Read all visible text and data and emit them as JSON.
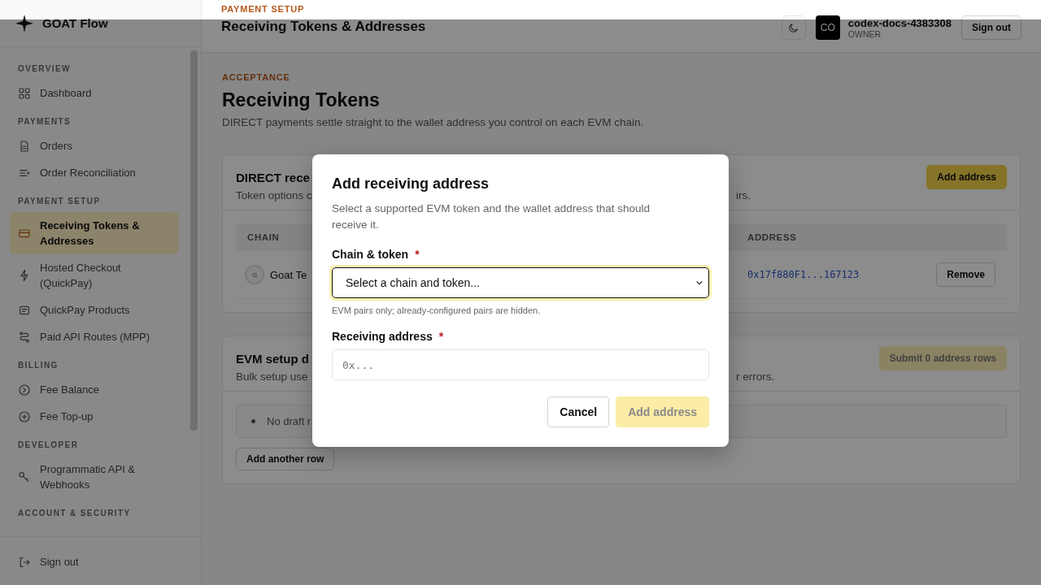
{
  "brand": {
    "name": "GOAT Flow"
  },
  "header": {
    "eyebrow": "PAYMENT SETUP",
    "title": "Receiving Tokens & Addresses",
    "avatar": "CO",
    "user_name": "codex-docs-4383308",
    "role": "OWNER",
    "sign_out": "Sign out"
  },
  "sidebar": {
    "sections": [
      {
        "heading": "OVERVIEW",
        "items": [
          {
            "label": "Dashboard",
            "selected": false
          }
        ]
      },
      {
        "heading": "PAYMENTS",
        "items": [
          {
            "label": "Orders",
            "selected": false
          },
          {
            "label": "Order Reconciliation",
            "selected": false
          }
        ]
      },
      {
        "heading": "PAYMENT SETUP",
        "items": [
          {
            "label": "Receiving Tokens & Addresses",
            "selected": true
          },
          {
            "label": "Hosted Checkout (QuickPay)",
            "selected": false
          },
          {
            "label": "QuickPay Products",
            "selected": false
          },
          {
            "label": "Paid API Routes (MPP)",
            "selected": false
          }
        ]
      },
      {
        "heading": "BILLING",
        "items": [
          {
            "label": "Fee Balance",
            "selected": false
          },
          {
            "label": "Fee Top-up",
            "selected": false
          }
        ]
      },
      {
        "heading": "DEVELOPER",
        "items": [
          {
            "label": "Programmatic API & Webhooks",
            "selected": false
          }
        ]
      },
      {
        "heading": "ACCOUNT & SECURITY"
      }
    ],
    "sign_out": "Sign out"
  },
  "page": {
    "eyebrow": "ACCEPTANCE",
    "title": "Receiving Tokens",
    "description": "DIRECT payments settle straight to the wallet address you control on each EVM chain."
  },
  "direct_card": {
    "title": "DIRECT rece",
    "subtitle_left": "Token options c",
    "subtitle_right": "irs.",
    "button": "Add address",
    "table": {
      "columns": [
        "CHAIN",
        "ADDRESS"
      ],
      "rows": [
        {
          "token_badge": "G",
          "chain": "Goat Te",
          "address": "0x17f880F1...167123",
          "action": "Remove"
        }
      ]
    }
  },
  "setup_card": {
    "title": "EVM setup d",
    "subtitle_left": "Bulk setup use",
    "subtitle_right": "r errors.",
    "button": "Submit 0 address rows",
    "button_disabled": true,
    "empty_note": "No draft r",
    "add_row": "Add another row"
  },
  "modal": {
    "title": "Add receiving address",
    "description": "Select a supported EVM token and the wallet address that should receive it.",
    "fields": [
      {
        "kind": "select",
        "label": "Chain & token",
        "required_mark": "*",
        "value": "Select a chain and token...",
        "focused": true,
        "hint": "EVM pairs only; already-configured pairs are hidden."
      },
      {
        "kind": "text",
        "label": "Receiving address",
        "required_mark": "*",
        "placeholder": "0x...",
        "focused": false
      }
    ],
    "cancel": "Cancel",
    "submit": "Add address",
    "submit_disabled": true
  }
}
